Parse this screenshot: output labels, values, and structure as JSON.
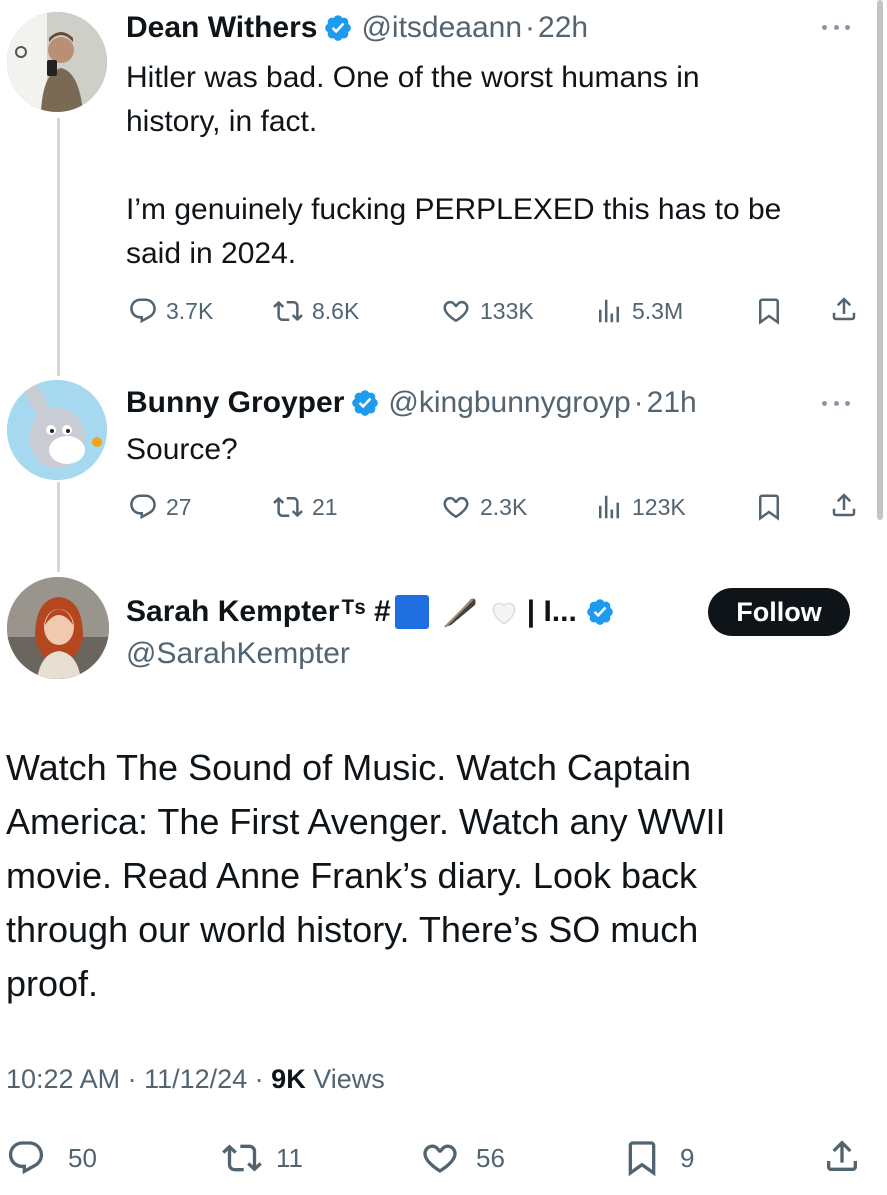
{
  "tweets": [
    {
      "name": "Dean Withers",
      "handle": "@itsdeaann",
      "time": "22h",
      "text": "Hitler was bad. One of the worst humans in\nhistory, in fact.\n\nI’m genuinely fucking PERPLEXED this has to be\nsaid in 2024.",
      "stats": {
        "replies": "3.7K",
        "reposts": "8.6K",
        "likes": "133K",
        "views": "5.3M"
      }
    },
    {
      "name": "Bunny Groyper",
      "handle": "@kingbunnygroyp",
      "time": "21h",
      "text": "Source?",
      "stats": {
        "replies": "27",
        "reposts": "21",
        "likes": "2.3K",
        "views": "123K"
      }
    }
  ],
  "main_tweet": {
    "name": "Sarah Kempter",
    "name_suffix": "ᵀˢ #",
    "name_trail": "| I...",
    "handle": "@SarahKempter",
    "follow_label": "Follow",
    "text": "Watch The Sound of Music. Watch Captain\nAmerica: The First Avenger. Watch any WWII\nmovie. Read Anne Frank’s diary. Look back\nthrough our world history. There’s SO much\nproof.",
    "timestamp": "10:22 AM · 11/12/24 · ",
    "views_count": "9K",
    "views_label": " Views",
    "stats": {
      "replies": "50",
      "reposts": "11",
      "likes": "56",
      "bookmarks": "9"
    }
  },
  "separator": "·",
  "colors": {
    "verified": "#1d9bf0",
    "text": "#0f1419",
    "muted": "#536471",
    "line": "#cfd9de"
  },
  "icons": [
    "reply-icon",
    "repost-icon",
    "like-icon",
    "views-icon",
    "bookmark-icon",
    "share-icon",
    "verified-icon",
    "more-icon",
    "feather-emoji",
    "white-heart-emoji",
    "blue-square-emoji"
  ]
}
